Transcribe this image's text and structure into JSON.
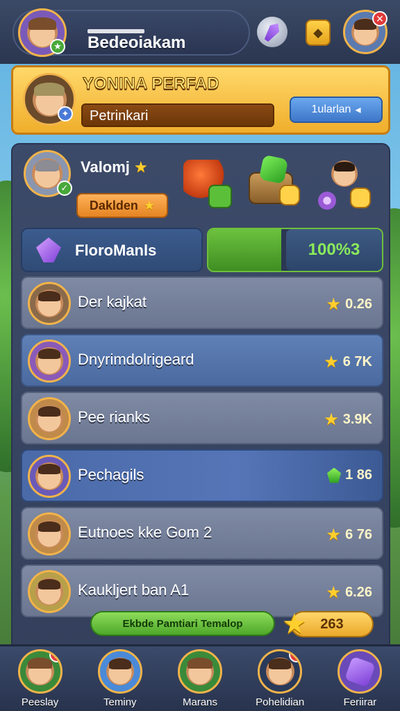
{
  "topbar": {
    "player_name": "Bedeoiakam",
    "key_icon_glyph": "◆",
    "close_glyph": "✕",
    "profile_badge_glyph": "★"
  },
  "banner": {
    "title": "YONINA PERFAD",
    "bar_text": "Petrinkari",
    "button_label": "1ularlan",
    "button_glyph": "◂"
  },
  "user_card": {
    "name": "Valomj",
    "name_star": "★",
    "action_label": "Daklden",
    "action_star": "★"
  },
  "section": {
    "label": "FloroManls",
    "progress_text": "100%3",
    "progress_fraction": 0.42
  },
  "leaderboard": [
    {
      "name": "Der kajkat",
      "score": "0.26",
      "icon": "star-icon",
      "style": "default"
    },
    {
      "name": "Dnyrimdolrigeard",
      "score": "6 7K",
      "icon": "star-icon",
      "style": "alt"
    },
    {
      "name": "Pee rianks",
      "score": "3.9K",
      "icon": "star-icon",
      "style": "default"
    },
    {
      "name": "Pechagils",
      "score": "1 86",
      "icon": "gem-icon",
      "style": "highlight"
    },
    {
      "name": "Eutnoes kke Gom 2",
      "score": "6 76",
      "icon": "star-icon",
      "style": "default"
    },
    {
      "name": "Kaukljert ban A1",
      "score": "6.26",
      "icon": "star-icon",
      "style": "default"
    }
  ],
  "footer_bar": {
    "pill_label": "Ekbde Pamtiari Temalop",
    "coins": "263"
  },
  "nav": [
    {
      "label": "Peeslay",
      "badge": "1",
      "name": "nav-peeslay"
    },
    {
      "label": "Teminy",
      "badge": "",
      "name": "nav-teminy"
    },
    {
      "label": "Marans",
      "badge": "",
      "name": "nav-marans"
    },
    {
      "label": "Pohelidian",
      "badge": "J",
      "name": "nav-pohelidian"
    },
    {
      "label": "Feriirar",
      "badge": "",
      "name": "nav-feriirar"
    }
  ],
  "colors": {
    "banner": "#f0ae2b",
    "panel": "#3c4a69",
    "progress_green": "#6cc23e",
    "star": "#ffcf2e"
  }
}
